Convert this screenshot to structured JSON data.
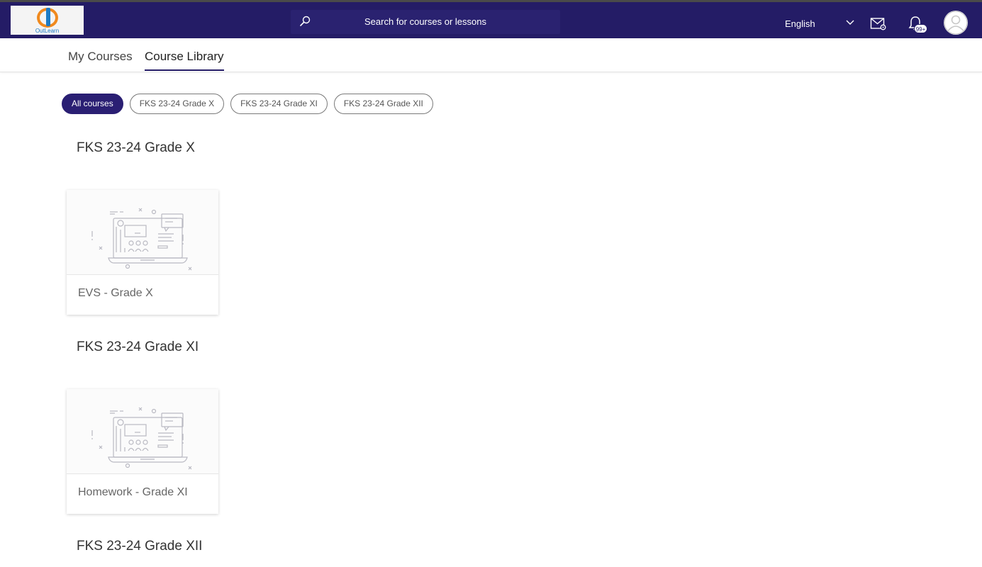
{
  "header": {
    "logo_text": "OutLearn",
    "search_placeholder": "Search for courses or lessons",
    "language": "English",
    "notification_badge": "99+"
  },
  "tabs": [
    {
      "label": "My Courses",
      "active": false
    },
    {
      "label": "Course Library",
      "active": true
    }
  ],
  "filters": [
    {
      "label": "All courses",
      "active": true
    },
    {
      "label": "FKS 23-24 Grade X",
      "active": false
    },
    {
      "label": "FKS 23-24 Grade XI",
      "active": false
    },
    {
      "label": "FKS 23-24 Grade XII",
      "active": false
    }
  ],
  "groups": [
    {
      "title": "FKS 23-24 Grade X",
      "courses": [
        {
          "name": "EVS - Grade X"
        }
      ]
    },
    {
      "title": "FKS 23-24 Grade XI",
      "courses": [
        {
          "name": "Homework - Grade XI"
        }
      ]
    },
    {
      "title": "FKS 23-24 Grade XII",
      "courses": []
    }
  ],
  "colors": {
    "header_bg": "#241c66",
    "active_chip": "#2a1f73",
    "logo_orange": "#f08a1e",
    "logo_blue": "#1e7bc4"
  }
}
